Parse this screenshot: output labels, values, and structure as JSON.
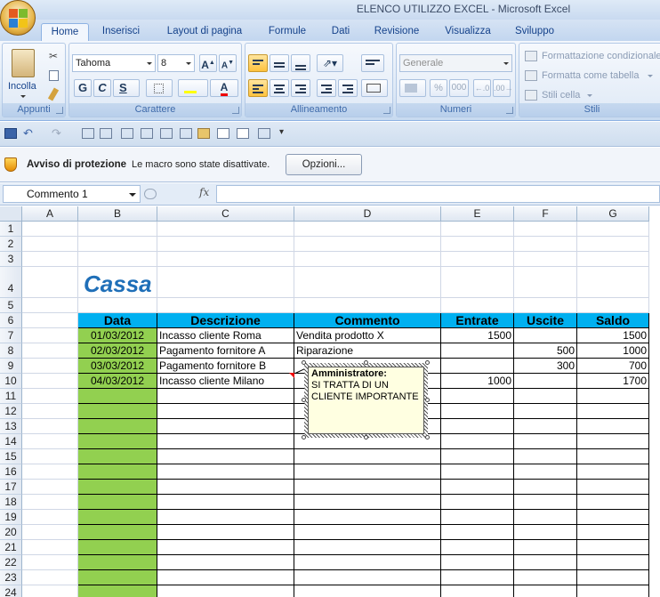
{
  "window": {
    "title": "ELENCO UTILIZZO EXCEL - Microsoft Excel"
  },
  "tabs": [
    "Home",
    "Inserisci",
    "Layout di pagina",
    "Formule",
    "Dati",
    "Revisione",
    "Visualizza",
    "Sviluppo"
  ],
  "active_tab": "Home",
  "ribbon": {
    "clipboard": {
      "paste_label": "Incolla",
      "group_label": "Appunti"
    },
    "font": {
      "name": "Tahoma",
      "size": "8",
      "bold": "G",
      "italic": "C",
      "underline": "S",
      "group_label": "Carattere"
    },
    "alignment": {
      "group_label": "Allineamento"
    },
    "number": {
      "format": "Generale",
      "percent": "%",
      "thousands": "000",
      "group_label": "Numeri"
    },
    "styles": {
      "conditional": "Formattazione condizionale",
      "as_table": "Formatta come tabella",
      "cell_styles": "Stili cella",
      "group_label": "Stili"
    }
  },
  "security": {
    "title": "Avviso di protezione",
    "message": "Le macro sono state disattivate.",
    "button": "Opzioni..."
  },
  "formula_bar": {
    "name_box": "Commento 1",
    "fx": "fx",
    "content": ""
  },
  "columns": [
    "A",
    "B",
    "C",
    "D",
    "E",
    "F",
    "G"
  ],
  "rows": [
    "1",
    "2",
    "3",
    "4",
    "5",
    "6",
    "7",
    "8",
    "9",
    "10",
    "11",
    "12",
    "13",
    "14",
    "15",
    "16",
    "17",
    "18",
    "19",
    "20",
    "21",
    "22",
    "23",
    "24"
  ],
  "sheet": {
    "title": "Cassa",
    "headers": [
      "Data",
      "Descrizione",
      "Commento",
      "Entrate",
      "Uscite",
      "Saldo"
    ],
    "data": [
      [
        "01/03/2012",
        "Incasso cliente Roma",
        "Vendita prodotto X",
        "1500",
        "",
        "1500"
      ],
      [
        "02/03/2012",
        "Pagamento fornitore A",
        "Riparazione",
        "",
        "500",
        "1000"
      ],
      [
        "03/03/2012",
        "Pagamento fornitore B",
        "",
        "",
        "300",
        "700"
      ],
      [
        "04/03/2012",
        "Incasso cliente Milano",
        "",
        "1000",
        "",
        "1700"
      ]
    ]
  },
  "comment": {
    "author": "Amministratore:",
    "text": "SI TRATTA DI UN CLIENTE IMPORTANTE"
  },
  "colors": {
    "header_fill": "#00b0f0",
    "date_fill": "#92d050",
    "title_color": "#1f6fb8"
  }
}
